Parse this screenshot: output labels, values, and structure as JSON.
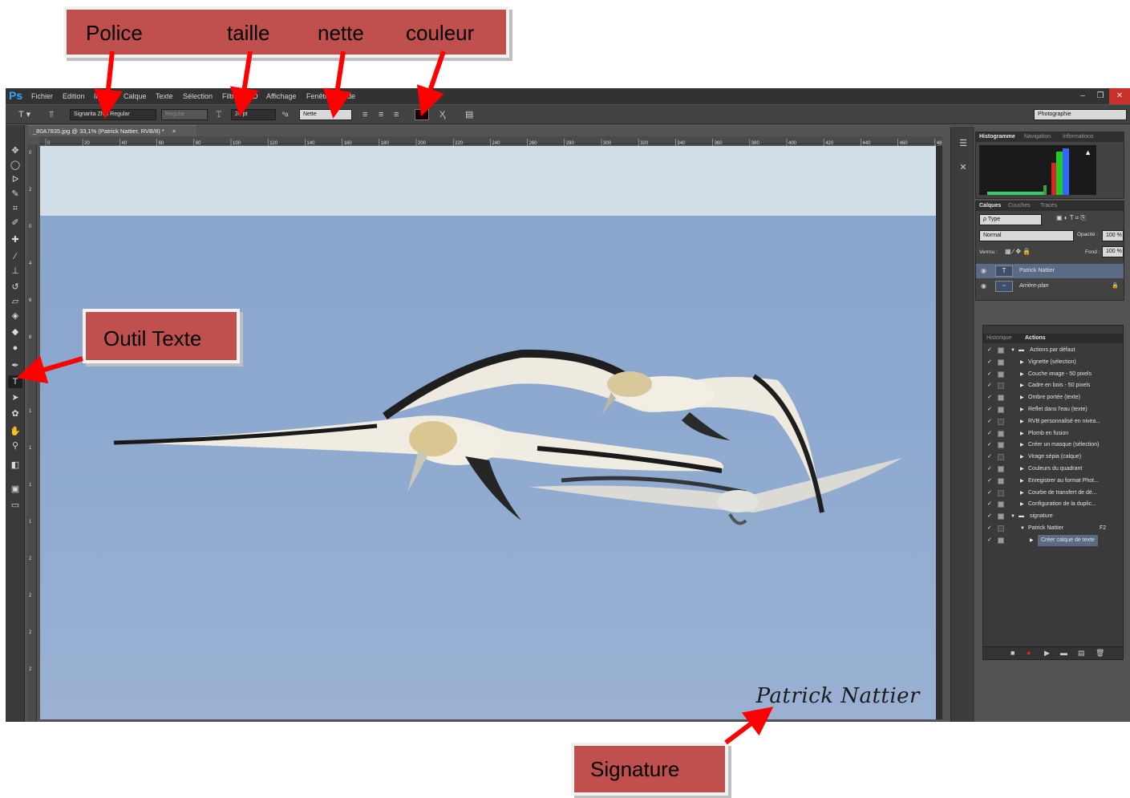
{
  "callouts": {
    "police": "Police",
    "taille": "taille",
    "nette": "nette",
    "couleur": "couleur",
    "outil_texte": "Outil Texte",
    "signature": "Signature"
  },
  "app": {
    "logo": "Ps",
    "menu": [
      "Fichier",
      "Edition",
      "Image",
      "Calque",
      "Texte",
      "Sélection",
      "Filtre",
      "3D",
      "Affichage",
      "Fenêtre",
      "Aide"
    ],
    "window_buttons": [
      "–",
      "❐",
      "✕"
    ]
  },
  "options_bar": {
    "font_family": "Signarita Zhai Regular",
    "font_style": "Regular",
    "font_size": "24 pt",
    "antialias_label": "ªa",
    "antialias": "Nette",
    "workspace": "Photographie"
  },
  "document": {
    "tab_title": "_80A7835.jpg @ 33,1% (Patrick Nattier, RVB/8) *",
    "ruler_ticks": [
      "0",
      "20",
      "40",
      "60",
      "80",
      "100",
      "120",
      "140",
      "160",
      "180",
      "200",
      "220",
      "240",
      "260",
      "280",
      "300",
      "320",
      "340",
      "360",
      "380",
      "400",
      "420",
      "440",
      "460",
      "48"
    ],
    "ruler_v_ticks": [
      "0",
      "2",
      "0",
      "4",
      "6",
      "8",
      "1",
      "1",
      "1",
      "1",
      "1",
      "2",
      "2",
      "2",
      "2"
    ],
    "signature_text": "Patrick Nattier"
  },
  "panels": {
    "histogram_tabs": [
      "Histogramme",
      "Navigation",
      "Informations"
    ],
    "layers_tabs": [
      "Calques",
      "Couches",
      "Tracés"
    ],
    "filter_kind": "ρ Type",
    "blend_mode": "Normal",
    "opacity_label": "Opacité :",
    "opacity_value": "100 %",
    "lock_label": "Verrou :",
    "fill_label": "Fond :",
    "fill_value": "100 %",
    "layers": [
      {
        "name": "Patrick Nattier",
        "thumb": "T"
      },
      {
        "name": "Arrière-plan",
        "thumb": "~"
      }
    ],
    "actions_tabs": [
      "Historique",
      "Actions"
    ],
    "actions": [
      {
        "label": "Actions par défaut",
        "level": 0,
        "folder": true
      },
      {
        "label": "Vignette (sélection)",
        "level": 1
      },
      {
        "label": "Couche image - 50 pixels",
        "level": 1
      },
      {
        "label": "Cadre en bois - 50 pixels",
        "level": 1
      },
      {
        "label": "Ombre portée (texte)",
        "level": 1
      },
      {
        "label": "Reflet dans l'eau (texte)",
        "level": 1
      },
      {
        "label": "RVB personnalisé en nivea...",
        "level": 1
      },
      {
        "label": "Plomb en fusion",
        "level": 1
      },
      {
        "label": "Créer un masque (sélection)",
        "level": 1
      },
      {
        "label": "Virage sépia (calque)",
        "level": 1
      },
      {
        "label": "Couleurs du quadrant",
        "level": 1
      },
      {
        "label": "Enregistrer au format Phot...",
        "level": 1
      },
      {
        "label": "Courbe de transfert de dé...",
        "level": 1
      },
      {
        "label": "Configuration de la duplic...",
        "level": 1
      },
      {
        "label": "signature",
        "level": 0,
        "folder": true
      },
      {
        "label": "Patrick Nattier",
        "level": 1,
        "shortcut": "F2"
      },
      {
        "label": "Créer calque de texte",
        "level": 2,
        "selected": true
      }
    ]
  },
  "colors": {
    "callout_fill": "#c0504d",
    "arrow": "#ff0000",
    "ps_bg": "#535353",
    "sky": "#8ea9cf"
  }
}
